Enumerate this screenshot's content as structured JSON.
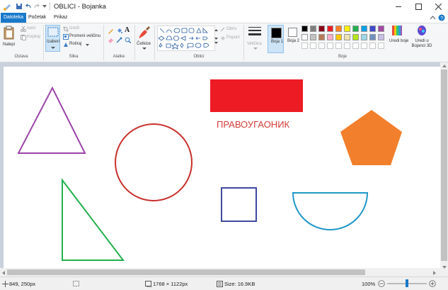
{
  "window": {
    "title": "OBLICI - Bojanka"
  },
  "tabs": [
    "Datoteka",
    "Početak",
    "Prikaz"
  ],
  "ribbon": {
    "clipboard": {
      "paste": "Nalepi",
      "cut": "Iseci",
      "copy": "Kopiraj",
      "group": "Ostava"
    },
    "image": {
      "select": "Izaberi",
      "crop": "Izreži",
      "resize": "Promeni veličinu",
      "rotate": "Rotiraj",
      "group": "Slika"
    },
    "tools": {
      "group": "Alatke"
    },
    "brushes": {
      "label": "Četkice"
    },
    "shapes": {
      "outline": "Obris",
      "fill": "Popuni",
      "group": "Oblici"
    },
    "size": {
      "label": "Veličina"
    },
    "colors": {
      "color1": "Boja 1",
      "color2": "Boja 2",
      "edit": "Uredi boje",
      "paint3d": "Uredi u Bojanci 3D",
      "group": "Boje",
      "palette_row1": [
        "#000000",
        "#7f7f7f",
        "#880015",
        "#ed1c24",
        "#ff7f27",
        "#fff200",
        "#22b14c",
        "#00a2e8",
        "#3f48cc",
        "#a349a4"
      ],
      "palette_row2": [
        "#ffffff",
        "#c3c3c3",
        "#b97a57",
        "#ffaec9",
        "#ffc90e",
        "#efe4b0",
        "#b5e61d",
        "#99d9ea",
        "#7092be",
        "#c8bfe7"
      ]
    }
  },
  "canvas": {
    "rect_label": "ПРАВОУГАОНИК",
    "colors": {
      "triangle": "#9b45a8",
      "circle": "#c9302c",
      "rectangle": "#ed1c24",
      "label": "#d33b35",
      "pentagon": "#f27f2c",
      "right_triangle": "#22b14c",
      "square": "#3f48a0",
      "semicircle": "#1f97c8"
    }
  },
  "status": {
    "cursor": "849, 250px",
    "dimensions": "1768 × 1122px",
    "size": "Size: 16.9KB",
    "zoom": "100%"
  }
}
